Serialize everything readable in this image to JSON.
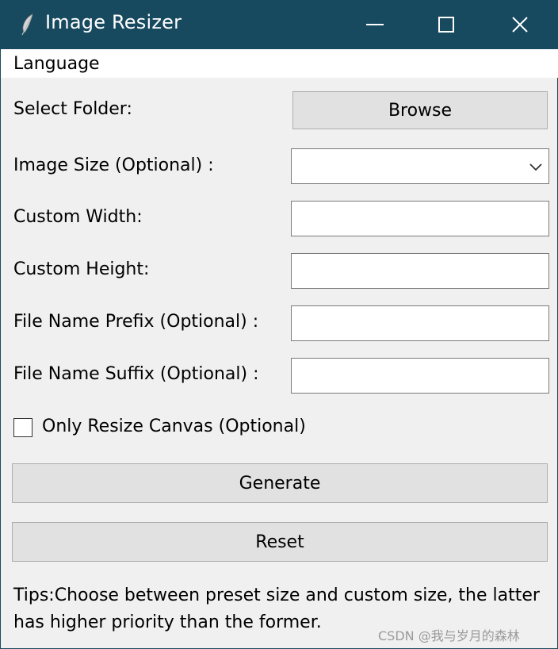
{
  "window": {
    "title": "Image Resizer",
    "controls": {
      "minimize": "minimize-icon",
      "maximize": "maximize-icon",
      "close": "close-icon"
    },
    "title_bar_color": "#174a5f"
  },
  "menu": {
    "items": [
      {
        "label": "Language"
      }
    ]
  },
  "form": {
    "select_folder_label": "Select Folder:",
    "browse_label": "Browse",
    "image_size_label": "Image Size (Optional) :",
    "image_size_value": "",
    "custom_width_label": "Custom Width:",
    "custom_width_value": "",
    "custom_height_label": "Custom Height:",
    "custom_height_value": "",
    "prefix_label": "File Name Prefix (Optional) :",
    "prefix_value": "",
    "suffix_label": "File Name Suffix (Optional) :",
    "suffix_value": "",
    "only_resize_canvas_label": "Only Resize Canvas (Optional)",
    "only_resize_canvas_checked": false
  },
  "actions": {
    "generate_label": "Generate",
    "reset_label": "Reset"
  },
  "tips": "Tips:Choose between preset size and custom size, the latter has higher priority than the former.",
  "watermark": "CSDN @我与岁月的森林"
}
